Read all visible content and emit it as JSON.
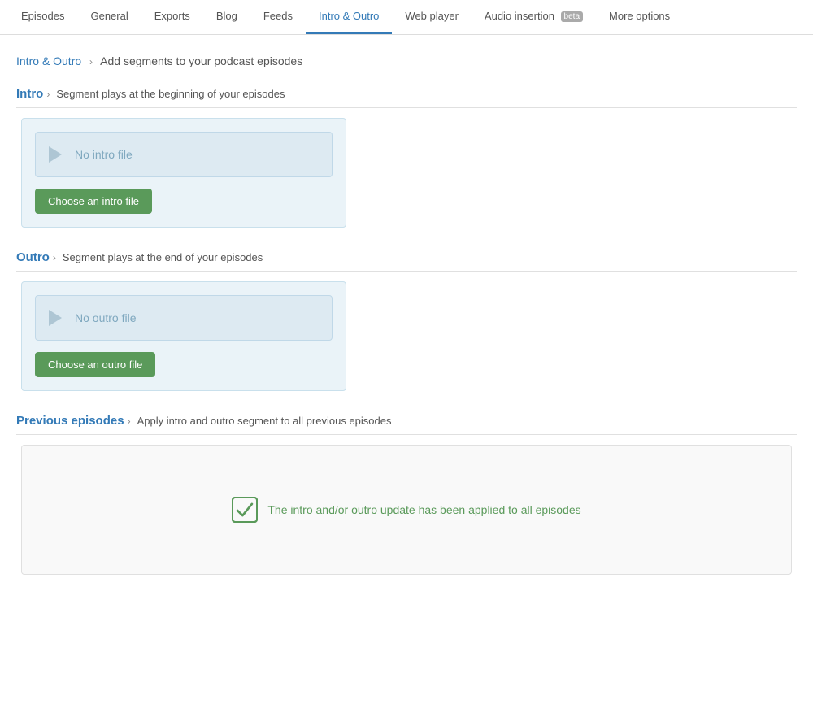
{
  "tabs": [
    {
      "id": "episodes",
      "label": "Episodes",
      "active": false
    },
    {
      "id": "general",
      "label": "General",
      "active": false
    },
    {
      "id": "exports",
      "label": "Exports",
      "active": false
    },
    {
      "id": "blog",
      "label": "Blog",
      "active": false
    },
    {
      "id": "feeds",
      "label": "Feeds",
      "active": false
    },
    {
      "id": "intro-outro",
      "label": "Intro & Outro",
      "active": true
    },
    {
      "id": "web-player",
      "label": "Web player",
      "active": false
    },
    {
      "id": "audio-insertion",
      "label": "Audio insertion",
      "active": false,
      "badge": "beta"
    },
    {
      "id": "more-options",
      "label": "More options",
      "active": false
    }
  ],
  "page": {
    "breadcrumb_link": "Intro & Outro",
    "breadcrumb_sub": "Add segments to your podcast episodes"
  },
  "intro": {
    "title": "Intro",
    "arrow": "›",
    "desc": "Segment plays at the beginning of your episodes",
    "no_file_text": "No intro file",
    "choose_btn_label": "Choose an intro file"
  },
  "outro": {
    "title": "Outro",
    "arrow": "›",
    "desc": "Segment plays at the end of your episodes",
    "no_file_text": "No outro file",
    "choose_btn_label": "Choose an outro file"
  },
  "previous": {
    "title": "Previous episodes",
    "arrow": "›",
    "desc": "Apply intro and outro segment to all previous episodes",
    "success_text": "The intro and/or outro update has been applied to all episodes"
  }
}
